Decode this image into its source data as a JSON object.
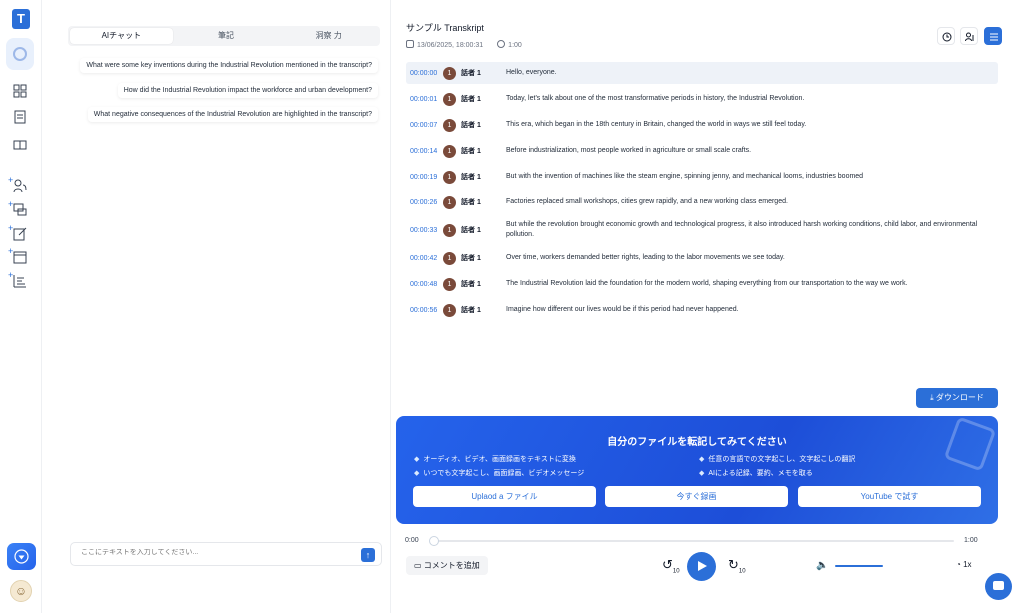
{
  "chat": {
    "tabs": [
      "AIチャット",
      "筆記",
      "洞察 力"
    ],
    "suggestions": [
      "What were some key inventions during the Industrial Revolution mentioned in the transcript?",
      "How did the Industrial Revolution impact the workforce and urban development?",
      "What negative consequences of the Industrial Revolution are highlighted in the transcript?"
    ],
    "input_placeholder": "ここにテキストを入力してください..."
  },
  "transcript": {
    "title": "サンプル Transkript",
    "date": "13/06/2025, 18:00:31",
    "duration": "1:00",
    "rows": [
      {
        "time": "00:00:00",
        "speaker_no": "1",
        "speaker": "話者 1",
        "text": "Hello, everyone."
      },
      {
        "time": "00:00:01",
        "speaker_no": "1",
        "speaker": "話者 1",
        "text": "Today, let's talk about one of the most transformative periods in history, the Industrial Revolution."
      },
      {
        "time": "00:00:07",
        "speaker_no": "1",
        "speaker": "話者 1",
        "text": "This era, which began in the 18th century in Britain, changed the world in ways we still feel today."
      },
      {
        "time": "00:00:14",
        "speaker_no": "1",
        "speaker": "話者 1",
        "text": "Before industrialization, most people worked in agriculture or small scale crafts."
      },
      {
        "time": "00:00:19",
        "speaker_no": "1",
        "speaker": "話者 1",
        "text": "But with the invention of machines like the steam engine, spinning jenny, and mechanical looms, industries boomed"
      },
      {
        "time": "00:00:26",
        "speaker_no": "1",
        "speaker": "話者 1",
        "text": "Factories replaced small workshops, cities grew rapidly, and a new working class emerged."
      },
      {
        "time": "00:00:33",
        "speaker_no": "1",
        "speaker": "話者 1",
        "text": "But while the revolution brought economic growth and technological progress, it also introduced harsh working conditions, child labor, and environmental pollution."
      },
      {
        "time": "00:00:42",
        "speaker_no": "1",
        "speaker": "話者 1",
        "text": "Over time, workers demanded better rights, leading to the labor movements we see today."
      },
      {
        "time": "00:00:48",
        "speaker_no": "1",
        "speaker": "話者 1",
        "text": "The Industrial Revolution laid the foundation for the modern world, shaping everything from our transportation to the way we work."
      },
      {
        "time": "00:00:56",
        "speaker_no": "1",
        "speaker": "話者 1",
        "text": "Imagine how different our lives would be if this period had never happened."
      }
    ]
  },
  "download_label": "ダウンロード",
  "promo": {
    "heading": "自分のファイルを転記してみてください",
    "features": [
      "オーディオ、ビデオ、画面録画をテキストに変換",
      "任意の言語での文字起こし、文字起こしの翻訳",
      "いつでも文字起こし、画面録画、ビデオメッセージ",
      "AIによる記録、要約、メモを取る"
    ],
    "buttons": [
      "Uplaod a ファイル",
      "今すぐ録画",
      "YouTube で試す"
    ]
  },
  "player": {
    "current": "0:00",
    "total": "1:00",
    "comment_label": "コメントを追加",
    "rewind": "10",
    "forward": "10",
    "speed": "1x",
    "progress": 0
  },
  "colors": {
    "accent": "#2b6fd8",
    "speaker_badge": "#7a4a3a"
  }
}
